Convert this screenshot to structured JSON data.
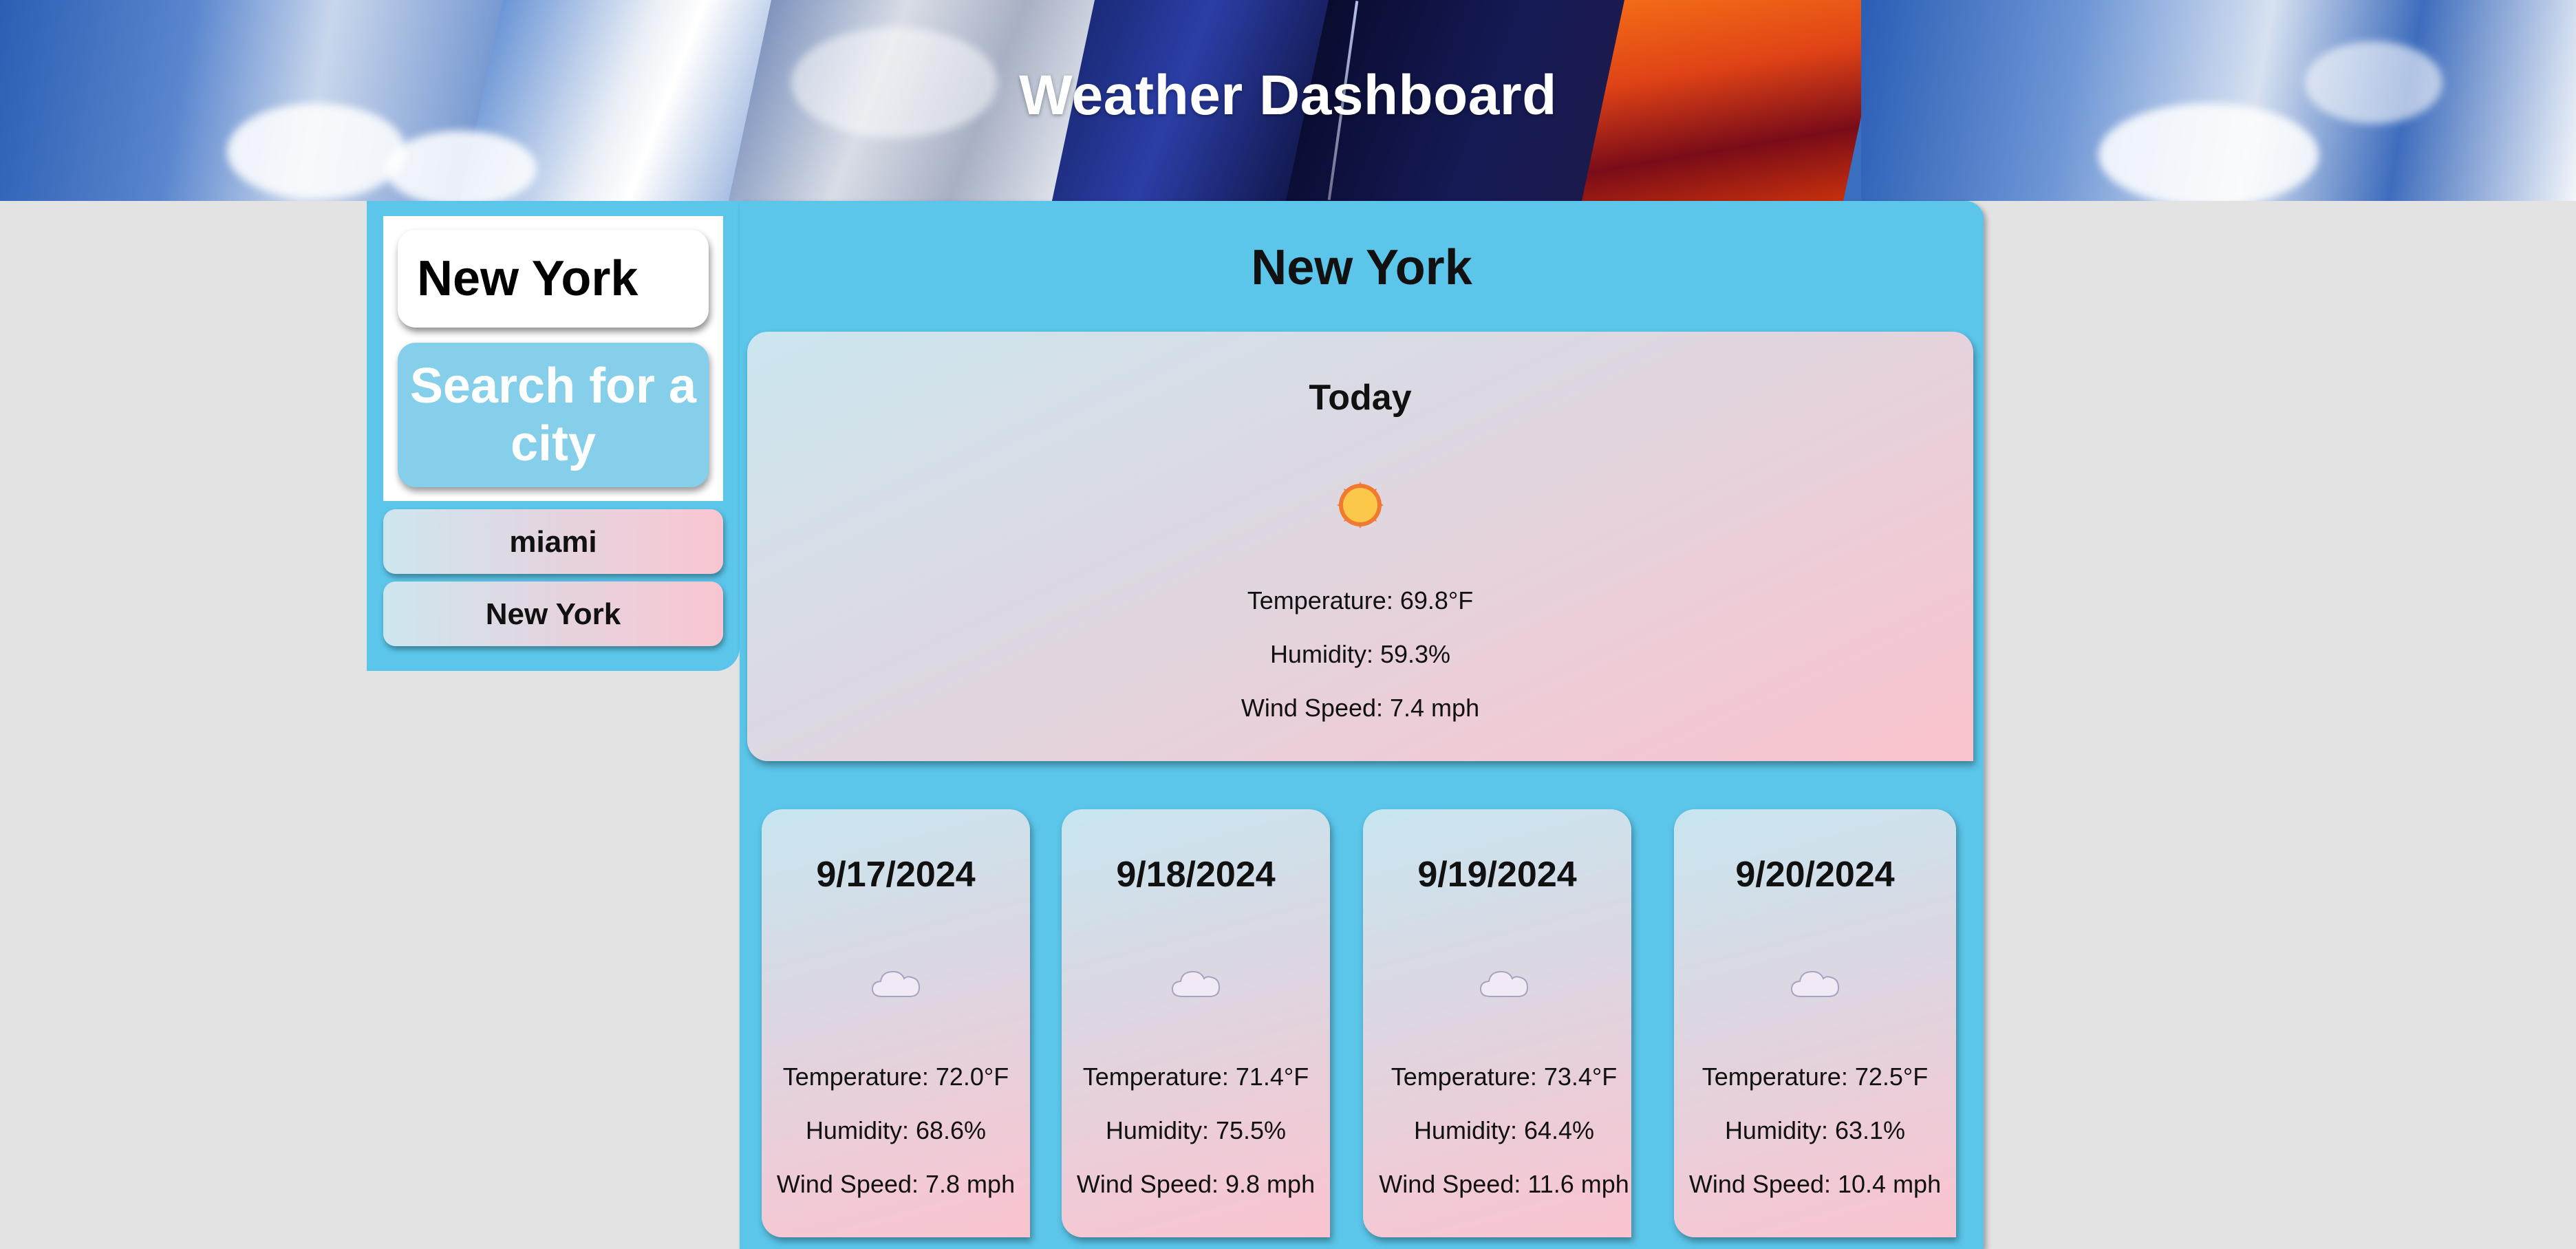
{
  "header": {
    "title": "Weather Dashboard"
  },
  "sidebar": {
    "search_value": "New York",
    "search_button_label": "Search for a city",
    "history": [
      "miami",
      "New York"
    ]
  },
  "current": {
    "city": "New York",
    "label": "Today",
    "icon": "sun-icon",
    "temperature": "Temperature: 69.8°F",
    "humidity": "Humidity: 59.3%",
    "wind": "Wind Speed: 7.4 mph"
  },
  "forecast": [
    {
      "date": "9/17/2024",
      "icon": "cloud-icon",
      "temperature": "Temperature: 72.0°F",
      "humidity": "Humidity: 68.6%",
      "wind": "Wind Speed: 7.8 mph"
    },
    {
      "date": "9/18/2024",
      "icon": "cloud-icon",
      "temperature": "Temperature: 71.4°F",
      "humidity": "Humidity: 75.5%",
      "wind": "Wind Speed: 9.8 mph"
    },
    {
      "date": "9/19/2024",
      "icon": "cloud-icon",
      "temperature": "Temperature: 73.4°F",
      "humidity": "Humidity: 64.4%",
      "wind": "Wind Speed: 11.6 mph"
    },
    {
      "date": "9/20/2024",
      "icon": "cloud-icon",
      "temperature": "Temperature: 72.5°F",
      "humidity": "Humidity: 63.1%",
      "wind": "Wind Speed: 10.4 mph"
    }
  ],
  "colors": {
    "panel": "#5bc6ea",
    "search_button": "#86cfea",
    "page_background": "#e3e3e3"
  }
}
